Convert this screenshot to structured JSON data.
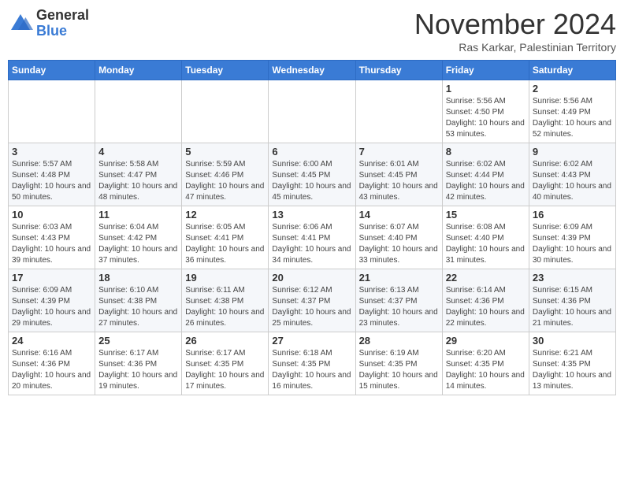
{
  "header": {
    "logo": {
      "general": "General",
      "blue": "Blue"
    },
    "title": "November 2024",
    "subtitle": "Ras Karkar, Palestinian Territory"
  },
  "weekdays": [
    "Sunday",
    "Monday",
    "Tuesday",
    "Wednesday",
    "Thursday",
    "Friday",
    "Saturday"
  ],
  "weeks": [
    [
      {
        "day": "",
        "info": ""
      },
      {
        "day": "",
        "info": ""
      },
      {
        "day": "",
        "info": ""
      },
      {
        "day": "",
        "info": ""
      },
      {
        "day": "",
        "info": ""
      },
      {
        "day": "1",
        "info": "Sunrise: 5:56 AM\nSunset: 4:50 PM\nDaylight: 10 hours and 53 minutes."
      },
      {
        "day": "2",
        "info": "Sunrise: 5:56 AM\nSunset: 4:49 PM\nDaylight: 10 hours and 52 minutes."
      }
    ],
    [
      {
        "day": "3",
        "info": "Sunrise: 5:57 AM\nSunset: 4:48 PM\nDaylight: 10 hours and 50 minutes."
      },
      {
        "day": "4",
        "info": "Sunrise: 5:58 AM\nSunset: 4:47 PM\nDaylight: 10 hours and 48 minutes."
      },
      {
        "day": "5",
        "info": "Sunrise: 5:59 AM\nSunset: 4:46 PM\nDaylight: 10 hours and 47 minutes."
      },
      {
        "day": "6",
        "info": "Sunrise: 6:00 AM\nSunset: 4:45 PM\nDaylight: 10 hours and 45 minutes."
      },
      {
        "day": "7",
        "info": "Sunrise: 6:01 AM\nSunset: 4:45 PM\nDaylight: 10 hours and 43 minutes."
      },
      {
        "day": "8",
        "info": "Sunrise: 6:02 AM\nSunset: 4:44 PM\nDaylight: 10 hours and 42 minutes."
      },
      {
        "day": "9",
        "info": "Sunrise: 6:02 AM\nSunset: 4:43 PM\nDaylight: 10 hours and 40 minutes."
      }
    ],
    [
      {
        "day": "10",
        "info": "Sunrise: 6:03 AM\nSunset: 4:43 PM\nDaylight: 10 hours and 39 minutes."
      },
      {
        "day": "11",
        "info": "Sunrise: 6:04 AM\nSunset: 4:42 PM\nDaylight: 10 hours and 37 minutes."
      },
      {
        "day": "12",
        "info": "Sunrise: 6:05 AM\nSunset: 4:41 PM\nDaylight: 10 hours and 36 minutes."
      },
      {
        "day": "13",
        "info": "Sunrise: 6:06 AM\nSunset: 4:41 PM\nDaylight: 10 hours and 34 minutes."
      },
      {
        "day": "14",
        "info": "Sunrise: 6:07 AM\nSunset: 4:40 PM\nDaylight: 10 hours and 33 minutes."
      },
      {
        "day": "15",
        "info": "Sunrise: 6:08 AM\nSunset: 4:40 PM\nDaylight: 10 hours and 31 minutes."
      },
      {
        "day": "16",
        "info": "Sunrise: 6:09 AM\nSunset: 4:39 PM\nDaylight: 10 hours and 30 minutes."
      }
    ],
    [
      {
        "day": "17",
        "info": "Sunrise: 6:09 AM\nSunset: 4:39 PM\nDaylight: 10 hours and 29 minutes."
      },
      {
        "day": "18",
        "info": "Sunrise: 6:10 AM\nSunset: 4:38 PM\nDaylight: 10 hours and 27 minutes."
      },
      {
        "day": "19",
        "info": "Sunrise: 6:11 AM\nSunset: 4:38 PM\nDaylight: 10 hours and 26 minutes."
      },
      {
        "day": "20",
        "info": "Sunrise: 6:12 AM\nSunset: 4:37 PM\nDaylight: 10 hours and 25 minutes."
      },
      {
        "day": "21",
        "info": "Sunrise: 6:13 AM\nSunset: 4:37 PM\nDaylight: 10 hours and 23 minutes."
      },
      {
        "day": "22",
        "info": "Sunrise: 6:14 AM\nSunset: 4:36 PM\nDaylight: 10 hours and 22 minutes."
      },
      {
        "day": "23",
        "info": "Sunrise: 6:15 AM\nSunset: 4:36 PM\nDaylight: 10 hours and 21 minutes."
      }
    ],
    [
      {
        "day": "24",
        "info": "Sunrise: 6:16 AM\nSunset: 4:36 PM\nDaylight: 10 hours and 20 minutes."
      },
      {
        "day": "25",
        "info": "Sunrise: 6:17 AM\nSunset: 4:36 PM\nDaylight: 10 hours and 19 minutes."
      },
      {
        "day": "26",
        "info": "Sunrise: 6:17 AM\nSunset: 4:35 PM\nDaylight: 10 hours and 17 minutes."
      },
      {
        "day": "27",
        "info": "Sunrise: 6:18 AM\nSunset: 4:35 PM\nDaylight: 10 hours and 16 minutes."
      },
      {
        "day": "28",
        "info": "Sunrise: 6:19 AM\nSunset: 4:35 PM\nDaylight: 10 hours and 15 minutes."
      },
      {
        "day": "29",
        "info": "Sunrise: 6:20 AM\nSunset: 4:35 PM\nDaylight: 10 hours and 14 minutes."
      },
      {
        "day": "30",
        "info": "Sunrise: 6:21 AM\nSunset: 4:35 PM\nDaylight: 10 hours and 13 minutes."
      }
    ]
  ]
}
